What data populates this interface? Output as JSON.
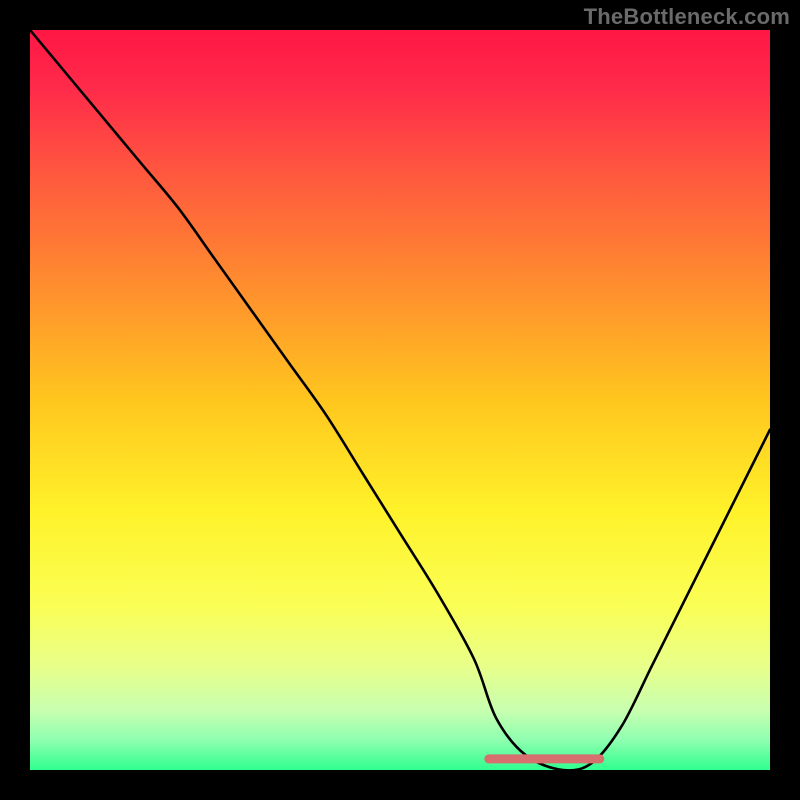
{
  "watermark": "TheBottleneck.com",
  "chart_data": {
    "type": "line",
    "title": "",
    "xlabel": "",
    "ylabel": "",
    "xlim": [
      0,
      100
    ],
    "ylim": [
      0,
      100
    ],
    "grid": false,
    "background": "spectral-gradient",
    "series": [
      {
        "name": "bottleneck-curve",
        "color": "#000000",
        "x": [
          0,
          5,
          10,
          15,
          20,
          25,
          30,
          35,
          40,
          45,
          50,
          55,
          60,
          63,
          67,
          72,
          76,
          80,
          84,
          88,
          92,
          96,
          100
        ],
        "values": [
          100,
          94,
          88,
          82,
          76,
          69,
          62,
          55,
          48,
          40,
          32,
          24,
          15,
          7,
          2,
          0,
          1,
          6,
          14,
          22,
          30,
          38,
          46
        ]
      }
    ],
    "annotations": [
      {
        "name": "optimal-zone",
        "type": "segment",
        "color": "#d76f6f",
        "x0": 62,
        "x1": 77,
        "y": 1.5
      }
    ]
  }
}
